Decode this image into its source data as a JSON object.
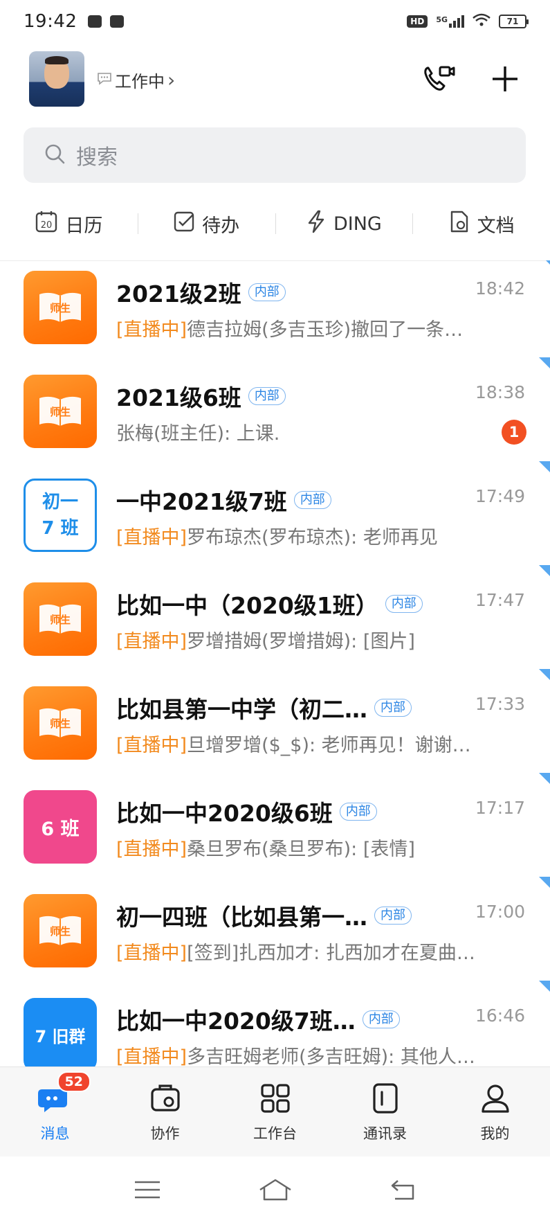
{
  "status_bar": {
    "time": "19:42",
    "network": "5G",
    "hd": "HD",
    "battery": "71"
  },
  "header": {
    "status_text": "工作中",
    "status_chevron": "›",
    "icons": [
      "video-call-icon",
      "plus-icon"
    ]
  },
  "search": {
    "placeholder": "搜索"
  },
  "quick_actions": [
    {
      "label": "日历",
      "icon": "calendar-icon",
      "calendar_day": "20"
    },
    {
      "label": "待办",
      "icon": "checkbox-icon"
    },
    {
      "label": "DING",
      "icon": "lightning-icon"
    },
    {
      "label": "文档",
      "icon": "document-icon"
    }
  ],
  "conversations": [
    {
      "title": "2021级2班",
      "badge": "内部",
      "time": "18:42",
      "live": "[直播中]",
      "preview": "德吉拉姆(多吉玉珍)撤回了一条…",
      "avatar_text": "师生",
      "avatar_style": "book",
      "unread": ""
    },
    {
      "title": "2021级6班",
      "badge": "内部",
      "time": "18:38",
      "live": "",
      "preview": "张梅(班主任): 上课.",
      "avatar_text": "师生",
      "avatar_style": "book",
      "unread": "1"
    },
    {
      "title": "一中2021级7班",
      "badge": "内部",
      "time": "17:49",
      "live": "[直播中]",
      "preview": "罗布琼杰(罗布琼杰): 老师再见",
      "avatar_text": "初一\n7 班",
      "avatar_style": "outline",
      "unread": ""
    },
    {
      "title": "比如一中（2020级1班）",
      "badge": "内部",
      "time": "17:47",
      "live": "[直播中]",
      "preview": "罗增措姆(罗增措姆): [图片]",
      "avatar_text": "师生",
      "avatar_style": "book",
      "unread": ""
    },
    {
      "title": "比如县第一中学（初二…",
      "badge": "内部",
      "time": "17:33",
      "live": "[直播中]",
      "preview": "旦增罗增($_$): 老师再见！谢谢…",
      "avatar_text": "师生",
      "avatar_style": "book",
      "unread": ""
    },
    {
      "title": "比如一中2020级6班",
      "badge": "内部",
      "time": "17:17",
      "live": "[直播中]",
      "preview": "桑旦罗布(桑旦罗布): [表情]",
      "avatar_text": "6 班",
      "avatar_style": "pink",
      "unread": ""
    },
    {
      "title": "初一四班（比如县第一…",
      "badge": "内部",
      "time": "17:00",
      "live": "[直播中]",
      "preview": "[签到]扎西加才: 扎西加才在夏曲…",
      "avatar_text": "师生",
      "avatar_style": "book",
      "unread": ""
    },
    {
      "title": "比如一中2020级7班…",
      "badge": "内部",
      "time": "16:46",
      "live": "[直播中]",
      "preview": "多吉旺姆老师(多吉旺姆): 其他人…",
      "avatar_text": "7 旧群",
      "avatar_style": "blue",
      "unread": ""
    }
  ],
  "tabs": [
    {
      "label": "消息",
      "icon": "message-icon",
      "active": true,
      "badge": "52"
    },
    {
      "label": "协作",
      "icon": "collaboration-icon",
      "active": false,
      "badge": ""
    },
    {
      "label": "工作台",
      "icon": "workbench-grid-icon",
      "active": false,
      "badge": ""
    },
    {
      "label": "通讯录",
      "icon": "contacts-icon",
      "active": false,
      "badge": ""
    },
    {
      "label": "我的",
      "icon": "profile-icon",
      "active": false,
      "badge": ""
    }
  ],
  "colors": {
    "accent_blue": "#1b7ff2",
    "live_orange": "#f28a1e",
    "unread_red": "#f25022"
  }
}
